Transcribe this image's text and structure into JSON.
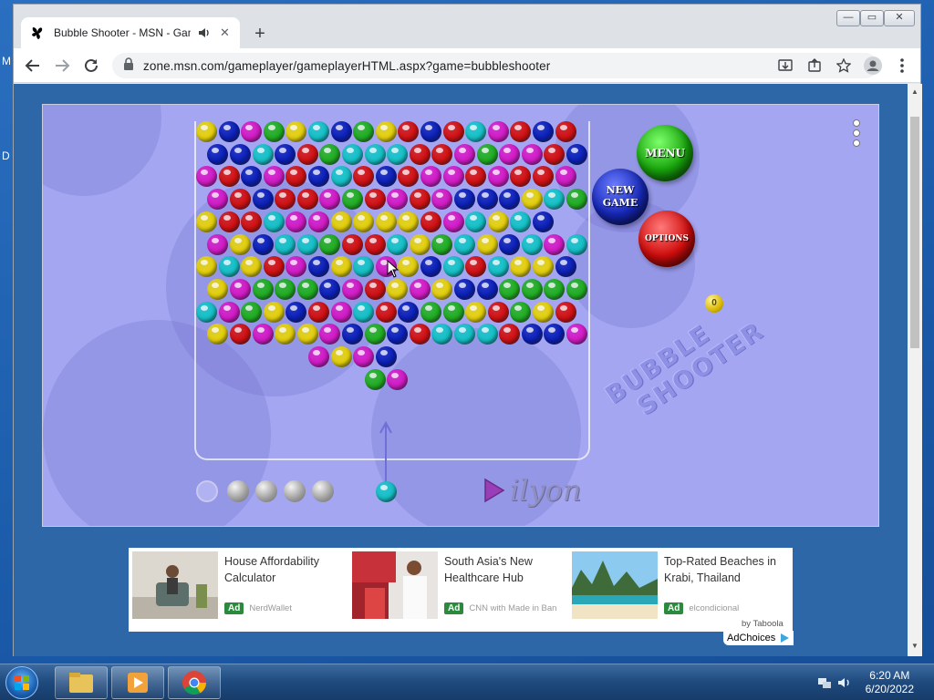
{
  "desktop": {
    "letter_m": "M",
    "letter_d": "D"
  },
  "browser": {
    "tab": {
      "title": "Bubble Shooter - MSN - Gam",
      "close": "✕"
    },
    "new_tab": "+",
    "url": "zone.msn.com/gameplayer/gameplayerHTML.aspx?game=bubbleshooter",
    "window_controls": {
      "minimize": "—",
      "maximize": "▭",
      "close": "✕"
    }
  },
  "game": {
    "buttons": {
      "menu": "MENU",
      "new_game_line1": "NEW",
      "new_game_line2": "GAME",
      "options": "OPTIONS"
    },
    "logo_line1": "BUBBLE",
    "logo_line2": "SHOOTER",
    "brand": "ilyon",
    "score_ball": "0",
    "colors": {
      "Y": "#e8d40a",
      "B": "#0a1fb8",
      "M": "#d51ac7",
      "G": "#20b020",
      "C": "#14c4c8",
      "R": "#d41010"
    },
    "rows": [
      "YBMGYCBGYRBRCMRBR",
      "BBCBRGCCCRRMGMMRB",
      "MRBMRBCRBRMMRMRRM",
      "MRBRRMGRMRMBBBYCG",
      "YRRCMMYYYYRMCYCB",
      "MYBCCGRRCYGCYBCMC",
      "YCYRMBYCMYBCRCYYB",
      "YMGGGBMRYMYBBGGGG",
      "CMGYBRMCRBGGYRGYR",
      "YRMYYMBGBRCCCRBBM",
      "MYMB",
      "GM"
    ],
    "cannon_bubble": "C",
    "reserve_count": 4
  },
  "ads": [
    {
      "title": "House Affordability Calculator",
      "badge": "Ad",
      "source": "NerdWallet"
    },
    {
      "title": "South Asia's New Healthcare Hub",
      "badge": "Ad",
      "source": "CNN with Made in Ban..."
    },
    {
      "title": "Top-Rated Beaches in Krabi, Thailand",
      "badge": "Ad",
      "source": "elcondicional"
    }
  ],
  "taboola": "by Taboola",
  "adchoices": "AdChoices",
  "taskbar": {
    "time": "6:20 AM",
    "date": "6/20/2022"
  }
}
